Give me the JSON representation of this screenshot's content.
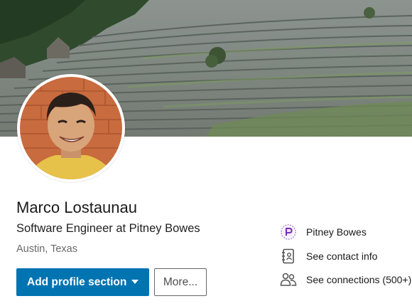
{
  "profile": {
    "name": "Marco Lostaunau",
    "headline": "Software Engineer at Pitney Bowes",
    "location": "Austin, Texas"
  },
  "actions": {
    "add_section_label": "Add profile section",
    "more_label": "More..."
  },
  "side_info": {
    "company": "Pitney Bowes",
    "contact_info": "See contact info",
    "connections": "See connections (500+)"
  },
  "icons": {
    "company": "pitney-bowes-logo",
    "contact": "address-book-icon",
    "connections": "people-icon",
    "dropdown": "caret-down-icon"
  },
  "colors": {
    "primary_button": "#0073b1",
    "company_logo": "#8a3fc0"
  }
}
